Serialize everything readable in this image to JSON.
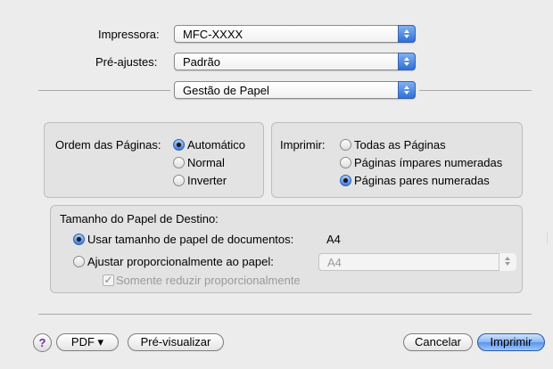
{
  "printer": {
    "label": "Impressora:",
    "value": "MFC-XXXX"
  },
  "presets": {
    "label": "Pré-ajustes:",
    "value": "Padrão"
  },
  "panel": {
    "value": "Gestão de Papel"
  },
  "page_order": {
    "label": "Ordem das Páginas:",
    "options": [
      {
        "label": "Automático",
        "selected": true
      },
      {
        "label": "Normal",
        "selected": false
      },
      {
        "label": "Inverter",
        "selected": false
      }
    ]
  },
  "print_pages": {
    "label": "Imprimir:",
    "options": [
      {
        "label": "Todas as Páginas",
        "selected": false
      },
      {
        "label": "Páginas ímpares numeradas",
        "selected": false
      },
      {
        "label": "Páginas pares numeradas",
        "selected": true
      }
    ]
  },
  "destination_paper": {
    "title": "Tamanho do Papel de Destino:",
    "use_document_size": {
      "label": "Usar tamanho de papel de documentos:",
      "value": "A4",
      "selected": true
    },
    "scale_to_paper": {
      "label": "Ajustar proporcionalmente ao papel:",
      "value": "A4",
      "selected": false
    },
    "scale_down_only": {
      "label": "Somente reduzir proporcionalmente",
      "checked": true,
      "enabled": false
    }
  },
  "footer": {
    "help": "?",
    "pdf": "PDF ▾",
    "preview": "Pré-visualizar",
    "cancel": "Cancelar",
    "print": "Imprimir"
  }
}
